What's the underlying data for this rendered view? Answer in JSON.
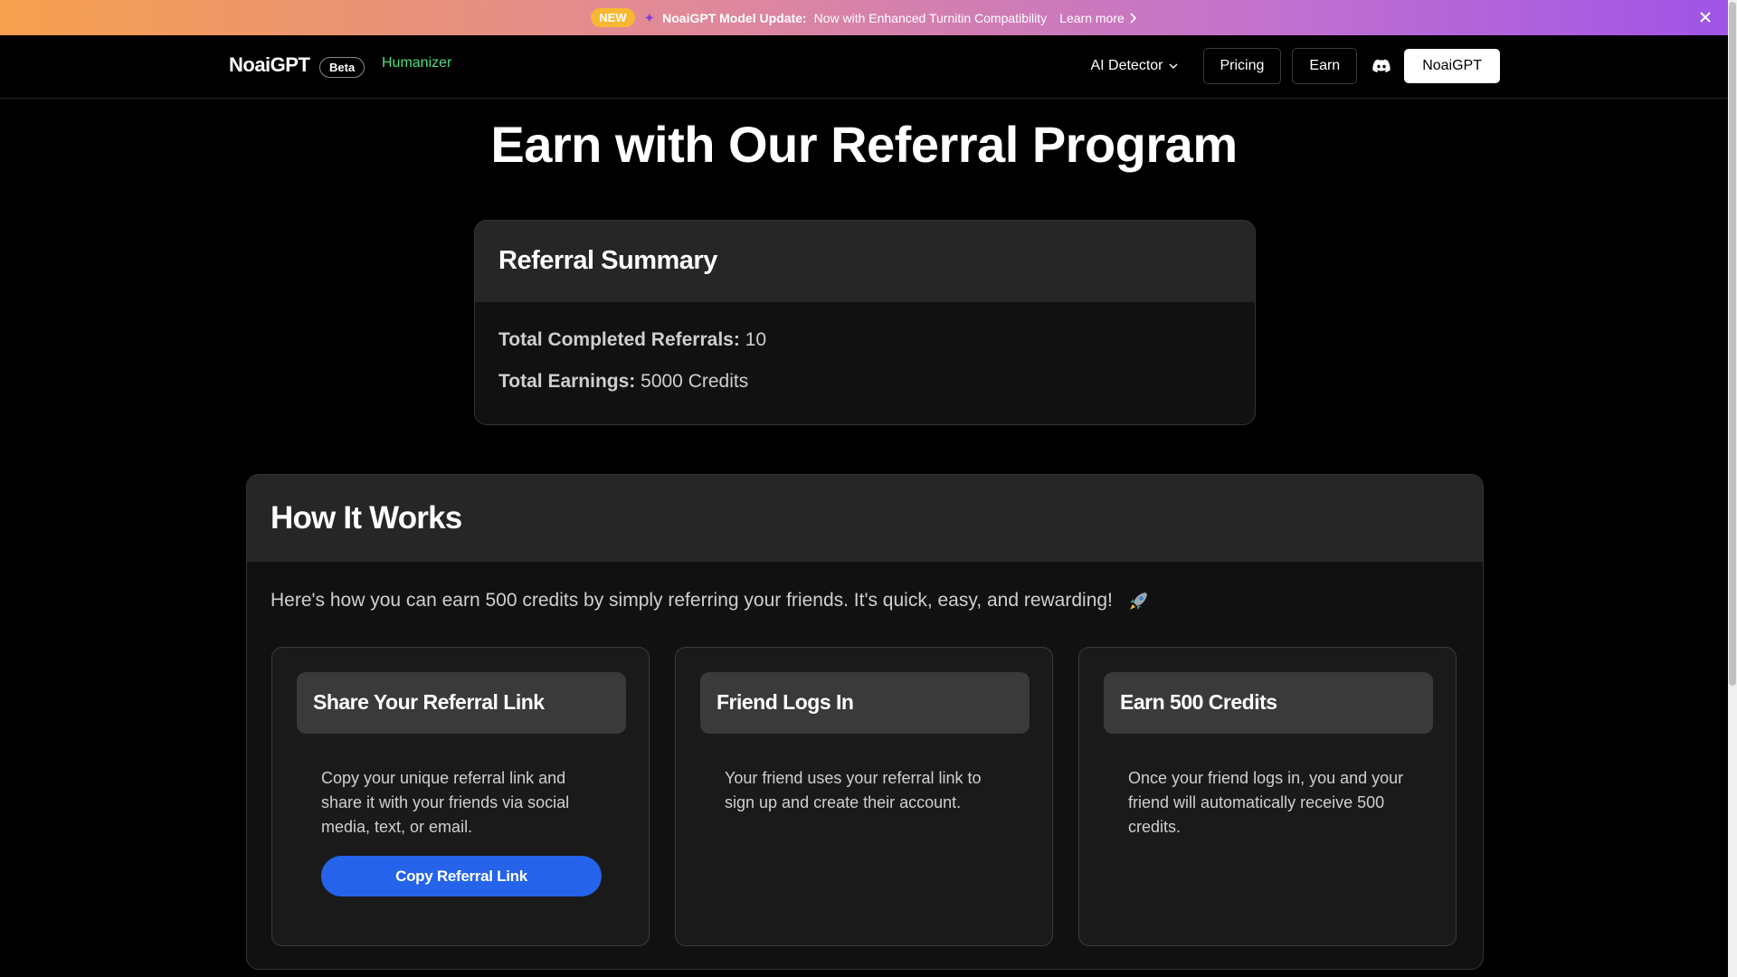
{
  "banner": {
    "badge": "NEW",
    "title": "NoaiGPT Model Update:",
    "text": "Now with Enhanced Turnitin Compatibility",
    "learn_more": "Learn more"
  },
  "header": {
    "logo": "NoaiGPT",
    "beta": "Beta",
    "humanizer": "Humanizer",
    "ai_detector": "AI Detector",
    "pricing": "Pricing",
    "earn": "Earn",
    "cta": "NoaiGPT"
  },
  "page": {
    "title": "Earn with Our Referral Program"
  },
  "summary": {
    "heading": "Referral Summary",
    "completed_label": "Total Completed Referrals:",
    "completed_value": "10",
    "earnings_label": "Total Earnings:",
    "earnings_value": "5000 Credits"
  },
  "how": {
    "heading": "How It Works",
    "intro": "Here's how you can earn 500 credits by simply referring your friends. It's quick, easy, and rewarding!",
    "steps": [
      {
        "title": "Share Your Referral Link",
        "text": "Copy your unique referral link and share it with your friends via social media, text, or email.",
        "button": "Copy Referral Link"
      },
      {
        "title": "Friend Logs In",
        "text": "Your friend uses your referral link to sign up and create their account."
      },
      {
        "title": "Earn 500 Credits",
        "text": "Once your friend logs in, you and your friend will automatically receive 500 credits."
      }
    ]
  },
  "colors": {
    "accent_green": "#4ade80",
    "primary_blue": "#2563eb",
    "badge_yellow": "#f7b733"
  }
}
